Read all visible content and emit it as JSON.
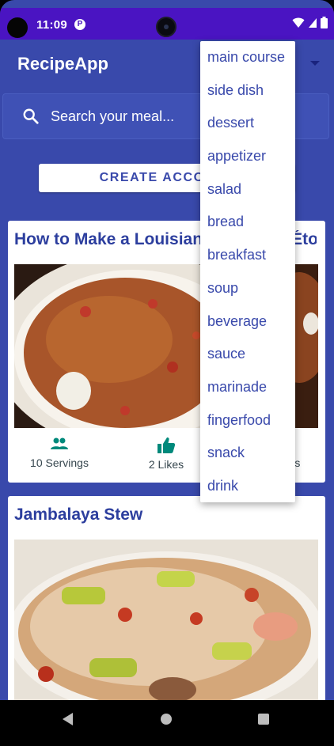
{
  "status_bar": {
    "time": "11:09",
    "app_icon_glyph": "ɓ"
  },
  "app": {
    "title": "RecipeApp"
  },
  "search": {
    "placeholder": "Search your meal..."
  },
  "create_account": {
    "label": "CREATE ACCOUNT"
  },
  "recipes": [
    {
      "title": "How to Make a Louisiana Crawfish Étouffee",
      "servings": "10 Servings",
      "likes": "2 Likes",
      "third_stat": "…es"
    },
    {
      "title": "Jambalaya Stew"
    }
  ],
  "dropdown": {
    "items": [
      "main course",
      "side dish",
      "dessert",
      "appetizer",
      "salad",
      "bread",
      "breakfast",
      "soup",
      "beverage",
      "sauce",
      "marinade",
      "fingerfood",
      "snack",
      "drink"
    ]
  },
  "colors": {
    "primary": "#3949ab",
    "status_bar": "#4a14c2",
    "accent_teal": "#00897b",
    "card_title": "#2c3e9e"
  },
  "icons": {
    "search": "search-icon",
    "servings": "people-icon",
    "likes": "thumb-up-icon",
    "wifi": "wifi-icon",
    "signal": "signal-icon",
    "battery": "battery-icon"
  }
}
